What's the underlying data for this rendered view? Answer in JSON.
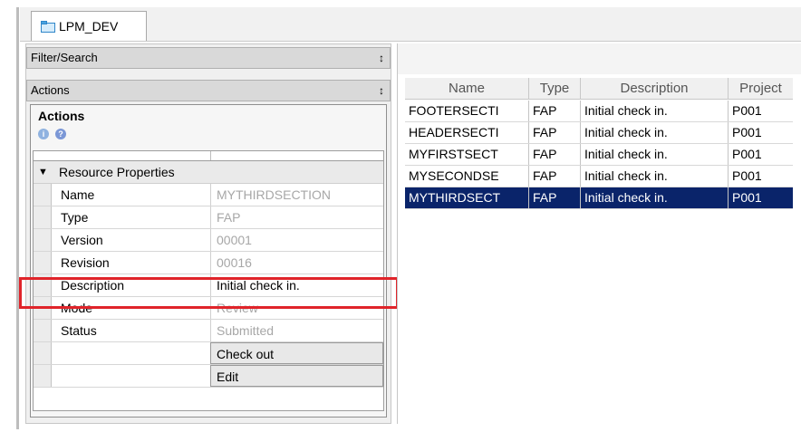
{
  "tab": {
    "label": "LPM_DEV"
  },
  "left_pane": {
    "filter_header": "Filter/Search",
    "actions_header": "Actions",
    "pin_glyph": "↕",
    "actions_title": "Actions",
    "icons": [
      "info-icon",
      "help-icon"
    ]
  },
  "resource_properties": {
    "section_label": "Resource Properties",
    "rows": [
      {
        "label": "Name",
        "value": "MYTHIRDSECTION"
      },
      {
        "label": "Type",
        "value": "FAP"
      },
      {
        "label": "Version",
        "value": "00001"
      },
      {
        "label": "Revision",
        "value": "00016"
      },
      {
        "label": "Description",
        "value": "Initial check in."
      },
      {
        "label": "Mode",
        "value": "Review"
      },
      {
        "label": "Status",
        "value": "Submitted"
      }
    ],
    "actions": [
      "Check out",
      "Edit"
    ]
  },
  "resource_grid": {
    "columns": [
      "Name",
      "Type",
      "Description",
      "Project"
    ],
    "rows": [
      [
        "FOOTERSECTI",
        "FAP",
        "Initial check in.",
        "P001"
      ],
      [
        "HEADERSECTI",
        "FAP",
        "Initial check in.",
        "P001"
      ],
      [
        "MYFIRSTSECT",
        "FAP",
        "Initial check in.",
        "P001"
      ],
      [
        "MYSECONDSE",
        "FAP",
        "Initial check in.",
        "P001"
      ],
      [
        "MYTHIRDSECT",
        "FAP",
        "Initial check in.",
        "P001"
      ]
    ],
    "selected_row": 4
  },
  "colors": {
    "selection": "#0a246a",
    "highlight_box": "#e0242a"
  }
}
